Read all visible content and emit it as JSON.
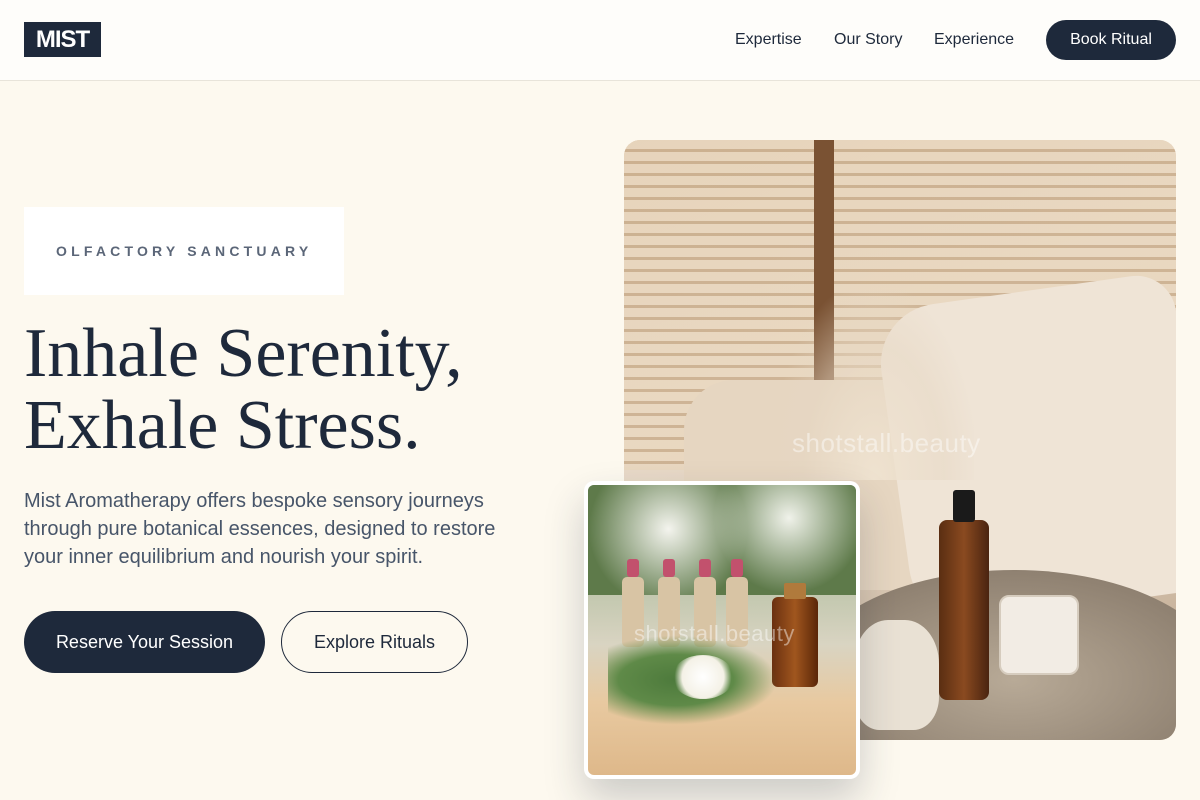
{
  "header": {
    "logo": "MIST",
    "nav": [
      {
        "label": "Expertise"
      },
      {
        "label": "Our Story"
      },
      {
        "label": "Experience"
      }
    ],
    "cta_label": "Book Ritual"
  },
  "hero": {
    "eyebrow": "OLFACTORY SANCTUARY",
    "headline_line1": "Inhale Serenity,",
    "headline_line2": "Exhale Stress.",
    "description": "Mist Aromatherapy offers bespoke sensory journeys through pure botanical essences, designed to restore your inner equilibrium and nourish your spirit.",
    "primary_button": "Reserve Your Session",
    "secondary_button": "Explore Rituals"
  },
  "images": {
    "main_watermark": "shotstall.beauty",
    "inset_watermark": "shotstall.beauty"
  },
  "colors": {
    "background": "#fdf9ef",
    "primary": "#1e293b",
    "muted_text": "#475569"
  }
}
